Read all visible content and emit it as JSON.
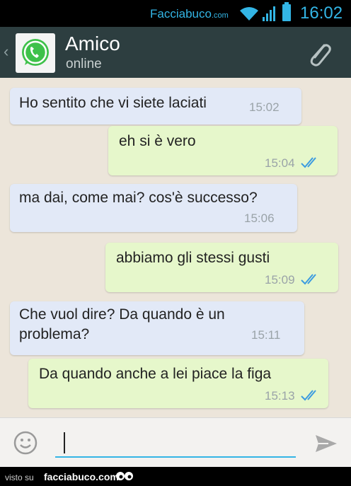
{
  "statusbar": {
    "watermark": "Facciabuco",
    "watermark_suffix": ".com",
    "time": "16:02"
  },
  "header": {
    "back_glyph": "‹",
    "contact_name": "Amico",
    "contact_status": "online",
    "icons": [
      "back-chevron-icon",
      "whatsapp-icon",
      "paperclip-icon"
    ]
  },
  "messages": [
    {
      "direction": "in",
      "text": "Ho sentito che vi siete laciati",
      "time": "15:02",
      "read": false
    },
    {
      "direction": "out",
      "text": "eh si è vero",
      "time": "15:04",
      "read": true
    },
    {
      "direction": "in",
      "text": "ma dai, come mai? cos'è successo?",
      "time": "15:06",
      "read": false
    },
    {
      "direction": "out",
      "text": "abbiamo gli stessi gusti",
      "time": "15:09",
      "read": true
    },
    {
      "direction": "in",
      "text": "Che vuol dire? Da quando è un problema?",
      "time": "15:11",
      "read": false
    },
    {
      "direction": "out",
      "text": "Da quando anche a lei piace la figa",
      "time": "15:13",
      "read": true
    }
  ],
  "input": {
    "value": "",
    "icons": [
      "emoji-icon",
      "send-icon"
    ]
  },
  "footer": {
    "visto_label": "visto su",
    "site": "facciabuco.com"
  },
  "colors": {
    "header_bg": "#2d3e40",
    "incoming_bubble": "#e2e9f7",
    "outgoing_bubble": "#e6f7cb",
    "accent": "#33b5e5",
    "read_ticks": "#3b9be0"
  }
}
